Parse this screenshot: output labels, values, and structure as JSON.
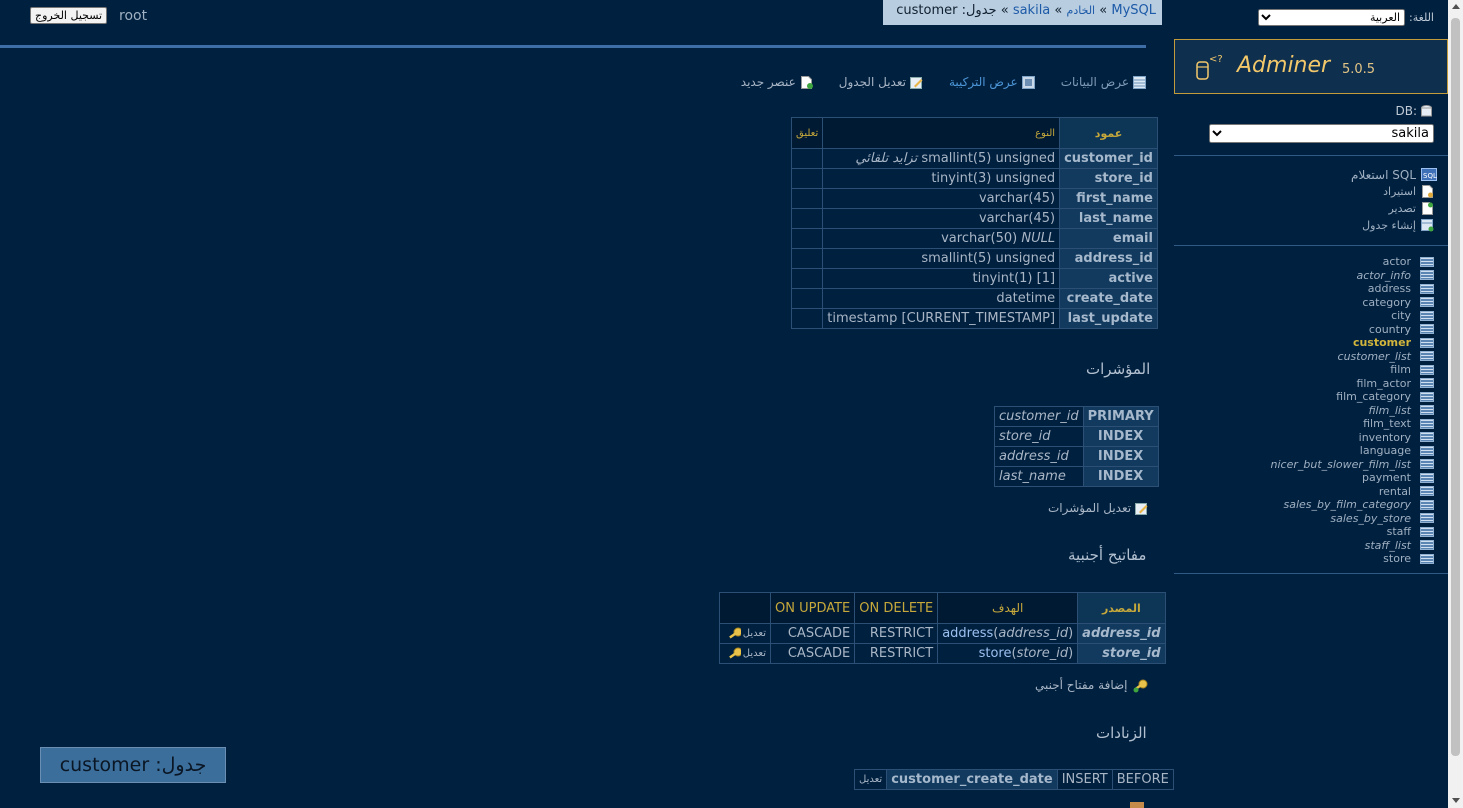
{
  "breadcrumb": {
    "driver": "MySQL",
    "server": "الخادم",
    "database": "sakila",
    "current": "جدول: customer",
    "sep": "»"
  },
  "header": {
    "logout_label": "تسجيل الخروج",
    "user": "root"
  },
  "actions": {
    "select_data": "عرض البيانات",
    "show_structure": "عرض التركيبة",
    "alter_table": "تعديل الجدول",
    "new_item": "عنصر جديد"
  },
  "columns_table": {
    "headers": {
      "column": "عمود",
      "type": "النوع",
      "comment": "تعليق"
    },
    "rows": [
      {
        "name": "customer_id",
        "type": "smallint(5) unsigned",
        "extra": "تزايد تلقائي",
        "extra_style": "italic"
      },
      {
        "name": "store_id",
        "type": "tinyint(3) unsigned",
        "extra": "",
        "extra_style": ""
      },
      {
        "name": "first_name",
        "type": "varchar(45)",
        "extra": "",
        "extra_style": ""
      },
      {
        "name": "last_name",
        "type": "varchar(45)",
        "extra": "",
        "extra_style": ""
      },
      {
        "name": "email",
        "type": "varchar(50)",
        "extra": "NULL",
        "extra_style": "italic"
      },
      {
        "name": "address_id",
        "type": "smallint(5) unsigned",
        "extra": "",
        "extra_style": ""
      },
      {
        "name": "active",
        "type": "tinyint(1)",
        "extra": "[1]",
        "extra_style": "default"
      },
      {
        "name": "create_date",
        "type": "datetime",
        "extra": "",
        "extra_style": ""
      },
      {
        "name": "last_update",
        "type": "timestamp",
        "extra": "[CURRENT_TIMESTAMP]",
        "extra_style": "default"
      }
    ]
  },
  "indexes": {
    "heading": "المؤشرات",
    "rows": [
      {
        "kind": "PRIMARY",
        "column": "customer_id"
      },
      {
        "kind": "INDEX",
        "column": "store_id"
      },
      {
        "kind": "INDEX",
        "column": "address_id"
      },
      {
        "kind": "INDEX",
        "column": "last_name"
      }
    ],
    "edit_link": "تعديل المؤشرات"
  },
  "foreign_keys": {
    "heading": "مفاتيح أجنبية",
    "headers": {
      "source": "المصدر",
      "target": "الهدف",
      "on_delete": "ON DELETE",
      "on_update": "ON UPDATE"
    },
    "rows": [
      {
        "source": "address_id",
        "target_table": "address",
        "target_column": "address_id",
        "on_delete": "RESTRICT",
        "on_update": "CASCADE",
        "edit": "تعديل"
      },
      {
        "source": "store_id",
        "target_table": "store",
        "target_column": "store_id",
        "on_delete": "RESTRICT",
        "on_update": "CASCADE",
        "edit": "تعديل"
      }
    ],
    "add_link": "إضافة مفتاح أجنبي"
  },
  "triggers": {
    "heading": "الزنادات",
    "rows": [
      {
        "timing": "BEFORE",
        "event": "INSERT",
        "name": "customer_create_date",
        "edit": "تعديل"
      }
    ]
  },
  "title_badge": "جدول: customer",
  "sidebar": {
    "language_label": "اللغة:",
    "language_value": "العربية",
    "app_name": "Adminer",
    "version": "5.0.5",
    "db_label": "DB:",
    "db_value": "sakila",
    "menu": {
      "sql": "استعلام SQL",
      "import": "استيراد",
      "export": "تصدير",
      "create_table": "إنشاء جدول"
    },
    "tables": [
      {
        "name": "actor",
        "view": false,
        "active": false
      },
      {
        "name": "actor_info",
        "view": true,
        "active": false
      },
      {
        "name": "address",
        "view": false,
        "active": false
      },
      {
        "name": "category",
        "view": false,
        "active": false
      },
      {
        "name": "city",
        "view": false,
        "active": false
      },
      {
        "name": "country",
        "view": false,
        "active": false
      },
      {
        "name": "customer",
        "view": false,
        "active": true
      },
      {
        "name": "customer_list",
        "view": true,
        "active": false
      },
      {
        "name": "film",
        "view": false,
        "active": false
      },
      {
        "name": "film_actor",
        "view": false,
        "active": false
      },
      {
        "name": "film_category",
        "view": false,
        "active": false
      },
      {
        "name": "film_list",
        "view": true,
        "active": false
      },
      {
        "name": "film_text",
        "view": false,
        "active": false
      },
      {
        "name": "inventory",
        "view": false,
        "active": false
      },
      {
        "name": "language",
        "view": false,
        "active": false
      },
      {
        "name": "nicer_but_slower_film_list",
        "view": true,
        "active": false
      },
      {
        "name": "payment",
        "view": false,
        "active": false
      },
      {
        "name": "rental",
        "view": false,
        "active": false
      },
      {
        "name": "sales_by_film_category",
        "view": true,
        "active": false
      },
      {
        "name": "sales_by_store",
        "view": true,
        "active": false
      },
      {
        "name": "staff",
        "view": false,
        "active": false
      },
      {
        "name": "staff_list",
        "view": true,
        "active": false
      },
      {
        "name": "store",
        "view": false,
        "active": false
      }
    ]
  },
  "colors": {
    "background": "#00203f",
    "accent": "#c6a83b",
    "link": "#9cc1f0"
  }
}
